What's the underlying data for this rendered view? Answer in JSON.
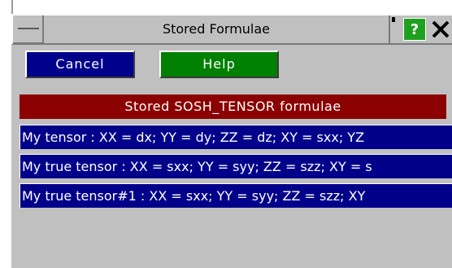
{
  "window": {
    "title": "Stored Formulae",
    "help_icon": "?",
    "close_icon": "✕"
  },
  "buttons": {
    "cancel": "Cancel",
    "help": "Help"
  },
  "list": {
    "header": "Stored SOSH_TENSOR formulae",
    "items": [
      {
        "label": "My tensor : XX = dx; YY = dy; ZZ = dz; XY = sxx; YZ"
      },
      {
        "label": "My true tensor : XX = sxx; YY = syy; ZZ = szz; XY = s"
      },
      {
        "label": "My true tensor#1 : XX = sxx; YY = syy; ZZ = szz; XY"
      }
    ]
  },
  "colors": {
    "cancel_bg": "#00008b",
    "help_bg": "#008000",
    "header_bg": "#8b0000",
    "item_bg": "#00008b",
    "help_icon_bg": "#20a020"
  }
}
